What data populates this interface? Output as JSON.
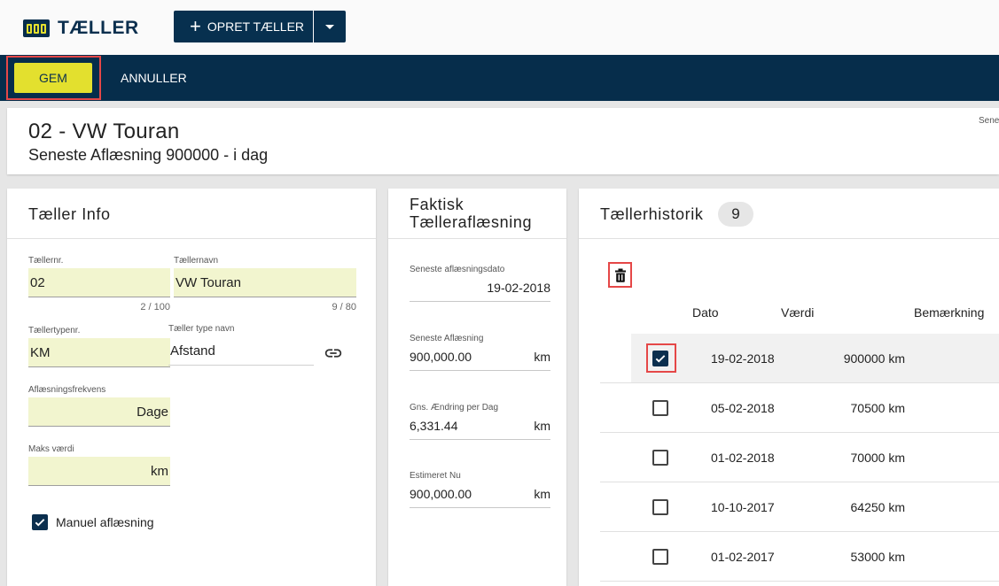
{
  "app": {
    "title": "TÆLLER"
  },
  "toolbar": {
    "create_label": "OPRET TÆLLER"
  },
  "actions": {
    "save_label": "GEM",
    "cancel_label": "ANNULLER"
  },
  "header": {
    "title": "02 - VW Touran",
    "subtitle": "Seneste Aflæsning 900000 - i dag",
    "right_text": "Sene"
  },
  "info": {
    "title": "Tæller Info",
    "nr": {
      "label": "Tællernr.",
      "value": "02",
      "count": "2 / 100"
    },
    "name": {
      "label": "Tællernavn",
      "value": "VW Touran",
      "count": "9 / 80"
    },
    "typenr": {
      "label": "Tællertypenr.",
      "value": "KM"
    },
    "typename": {
      "label": "Tæller type navn",
      "value": "Afstand"
    },
    "freq": {
      "label": "Aflæsningsfrekvens",
      "value": "Dage"
    },
    "max": {
      "label": "Maks værdi",
      "value": "km"
    },
    "manual": {
      "label": "Manuel aflæsning",
      "checked": true
    }
  },
  "faktisk": {
    "title_line1": "Faktisk",
    "title_line2": "Tælleraflæsning",
    "fields": [
      {
        "label": "Seneste aflæsningsdato",
        "value": "19-02-2018",
        "unit": ""
      },
      {
        "label": "Seneste Aflæsning",
        "value": "900,000.00",
        "unit": "km"
      },
      {
        "label": "Gns. Ændring per Dag",
        "value": "6,331.44",
        "unit": "km"
      },
      {
        "label": "Estimeret Nu",
        "value": "900,000.00",
        "unit": "km"
      }
    ]
  },
  "history": {
    "title": "Tællerhistorik",
    "count": "9",
    "columns": {
      "date": "Dato",
      "value": "Værdi",
      "note": "Bemærkning"
    },
    "rows": [
      {
        "date": "19-02-2018",
        "value": "900000 km",
        "checked": true
      },
      {
        "date": "05-02-2018",
        "value": "70500 km",
        "checked": false
      },
      {
        "date": "01-02-2018",
        "value": "70000 km",
        "checked": false
      },
      {
        "date": "10-10-2017",
        "value": "64250 km",
        "checked": false
      },
      {
        "date": "01-02-2017",
        "value": "53000 km",
        "checked": false
      }
    ]
  },
  "icons": {
    "logo": "counter-logo-icon",
    "plus": "plus-icon",
    "dropdown": "chevron-down-icon",
    "link": "link-icon",
    "delete": "trash-icon",
    "check": "checkmark-icon"
  },
  "colors": {
    "brand": "#062d4b",
    "accent": "#e3e02e",
    "field_bg": "#f2f5cf",
    "highlight": "#e54747"
  }
}
